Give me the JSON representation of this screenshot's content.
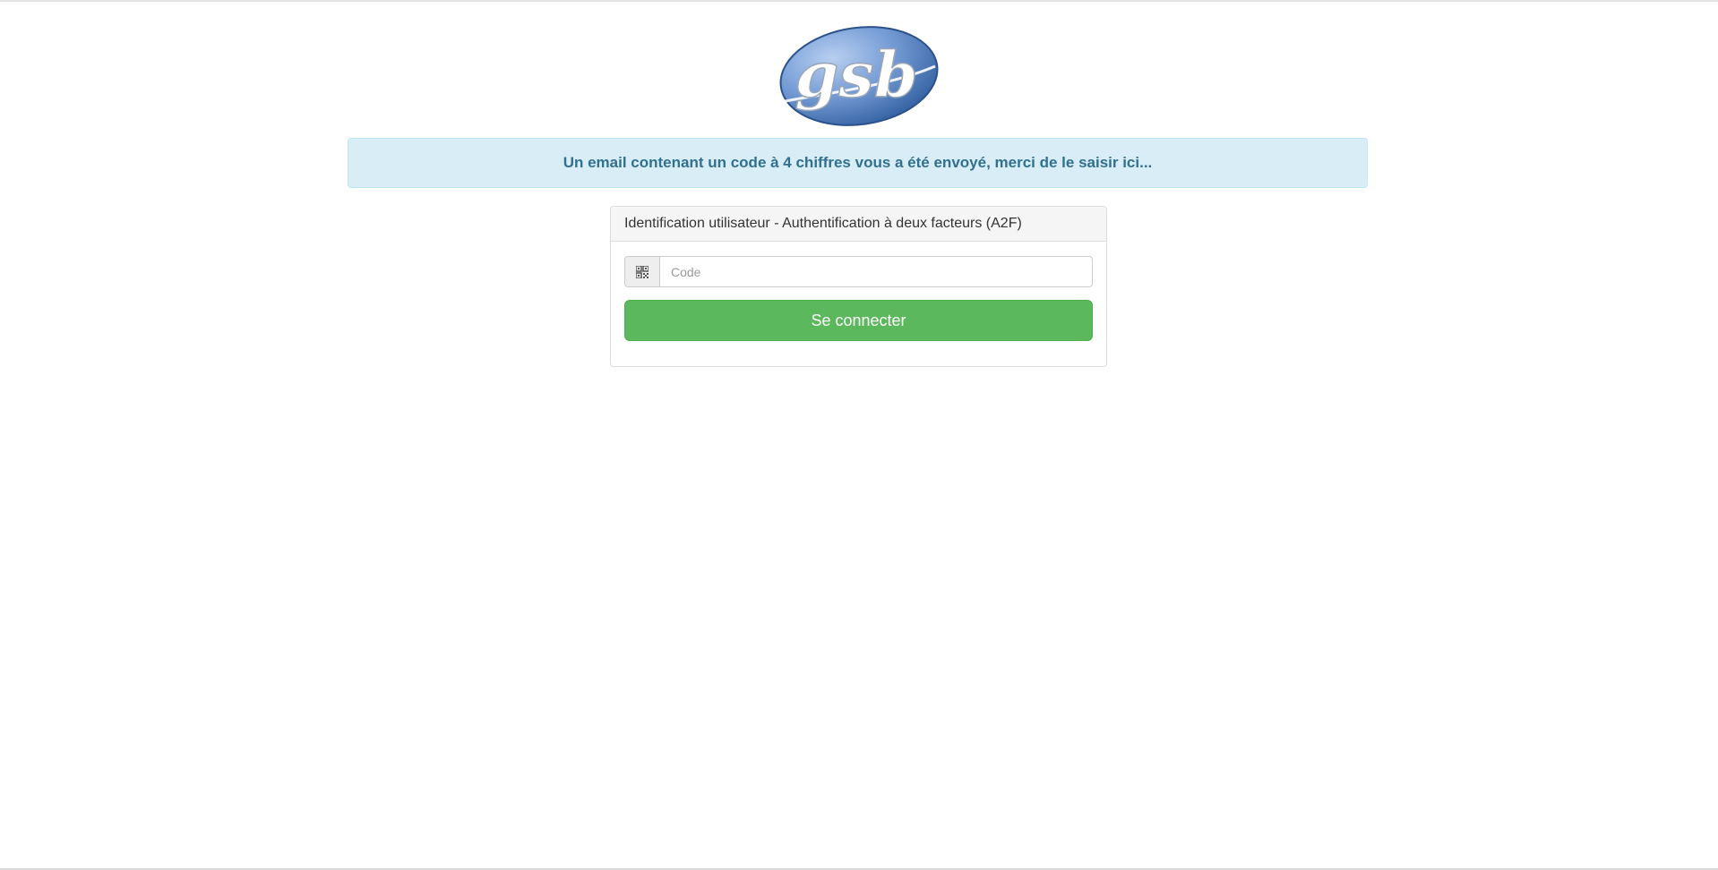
{
  "logo": {
    "text": "gsb",
    "colors": {
      "light": "#8fb0dd",
      "dark": "#2f5d9e"
    }
  },
  "alert": {
    "message": "Un email contenant un code à 4 chiffres vous a été envoyé, merci de le saisir ici..."
  },
  "panel": {
    "heading": "Identification utilisateur - Authentification à deux facteurs (A2F)",
    "input": {
      "icon": "qrcode-icon",
      "placeholder": "Code",
      "value": ""
    },
    "submit_label": "Se connecter"
  },
  "colors": {
    "alert_bg": "#d9edf7",
    "alert_text": "#31708f",
    "button_bg": "#5cb85c"
  }
}
